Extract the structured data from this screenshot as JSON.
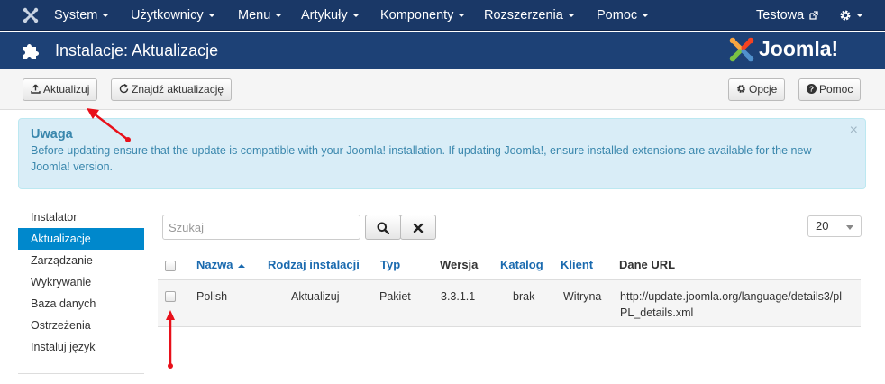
{
  "nav": {
    "items": [
      {
        "label": "System"
      },
      {
        "label": "Użytkownicy"
      },
      {
        "label": "Menu"
      },
      {
        "label": "Artykuły"
      },
      {
        "label": "Komponenty"
      },
      {
        "label": "Rozszerzenia"
      },
      {
        "label": "Pomoc"
      }
    ],
    "user": "Testowa"
  },
  "header": {
    "title": "Instalacje: Aktualizacje",
    "brand": "Joomla!"
  },
  "toolbar": {
    "update": "Aktualizuj",
    "find_updates": "Znajdź aktualizację",
    "options": "Opcje",
    "help": "Pomoc"
  },
  "alert": {
    "title": "Uwaga",
    "text": "Before updating ensure that the update is compatible with your Joomla! installation. If updating Joomla!, ensure installed extensions are available for the new Joomla! version."
  },
  "sidebar": {
    "items": [
      {
        "label": "Instalator"
      },
      {
        "label": "Aktualizacje"
      },
      {
        "label": "Zarządzanie"
      },
      {
        "label": "Wykrywanie"
      },
      {
        "label": "Baza danych"
      },
      {
        "label": "Ostrzeżenia"
      },
      {
        "label": "Instaluj język"
      }
    ],
    "active": "Aktualizacje"
  },
  "filter": {
    "search_placeholder": "Szukaj",
    "limit": "20"
  },
  "table": {
    "columns": [
      "Nazwa",
      "Rodzaj instalacji",
      "Typ",
      "Wersja",
      "Katalog",
      "Klient",
      "Dane URL"
    ],
    "rows": [
      {
        "name": "Polish",
        "install_type": "Aktualizuj",
        "type": "Pakiet",
        "version": "3.3.1.1",
        "folder": "brak",
        "client": "Witryna",
        "url_line1": "http://update.joomla.org/language/details3/pl-",
        "url_line2": "PL_details.xml"
      }
    ]
  },
  "colors": {
    "navbar": "#1a3867",
    "header": "#1d4176",
    "active_sidebar": "#0088cc",
    "alert_bg": "#d9edf7",
    "annotation_arrow": "#e8101a"
  }
}
